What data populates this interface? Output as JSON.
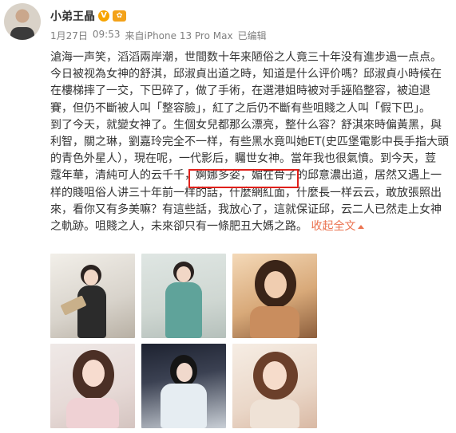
{
  "user": {
    "name": "小弟王晶",
    "vip_badge": "V",
    "level_badge": "✿"
  },
  "meta": {
    "date": "1月27日",
    "time": "09:53",
    "source": "来自iPhone 13 Pro Max",
    "edited": "已编辑"
  },
  "post": {
    "lines": [
      "滄海一声笑，滔滔兩岸潮，世間数十年来陋俗之人竟三十年没有進步過一点点。",
      "今日被视為女神的舒淇，邱淑貞出道之時，知道是什么评价嗎？邱淑貞小時候在",
      "在樓梯摔了一交，下巴碎了，做了手術，在選港姐時被对手誣陷整容，被迫退",
      "賽，但仍不斷被人叫「整容臉」，紅了之后仍不斷有些咀賤之人叫「假下巴」。",
      "到了今天，就變女神了。生個女兒都那么漂亮，整什么容？舒淇來時偏黃黑，與",
      "利智，關之琳，劉嘉玲完全不一样，有些黑水竟叫她ET(史匹堡電影中長手指大頭",
      "的青色外星人），現在呢，一代影后，矚世女神。當年我也很氣憤。到今天，荳",
      "蔻年華，清純可人的云千千，婀娜多姿，媚在骨子的邱意濃出道，居然又遇上一",
      "样的賤咀俗人讲三十年前一样的話，什麼網紅面，什麼長一样云云，敢放張照出",
      "來，看你又有多美嘛？有這些話，我放心了，這就保证邱，云二人已然走上女神",
      "之軌跡。咀賤之人，未來卻只有一條肥丑大媽之路。"
    ],
    "collapse_label": "收起全文"
  },
  "photos": [
    {
      "alt": "photo-1"
    },
    {
      "alt": "photo-2"
    },
    {
      "alt": "photo-3"
    },
    {
      "alt": "photo-4"
    },
    {
      "alt": "photo-5"
    },
    {
      "alt": "photo-6"
    }
  ],
  "colors": {
    "link": "#eb7350",
    "highlight_border": "#e0201a",
    "vip": "#f7a400",
    "meta_text": "#808080"
  }
}
